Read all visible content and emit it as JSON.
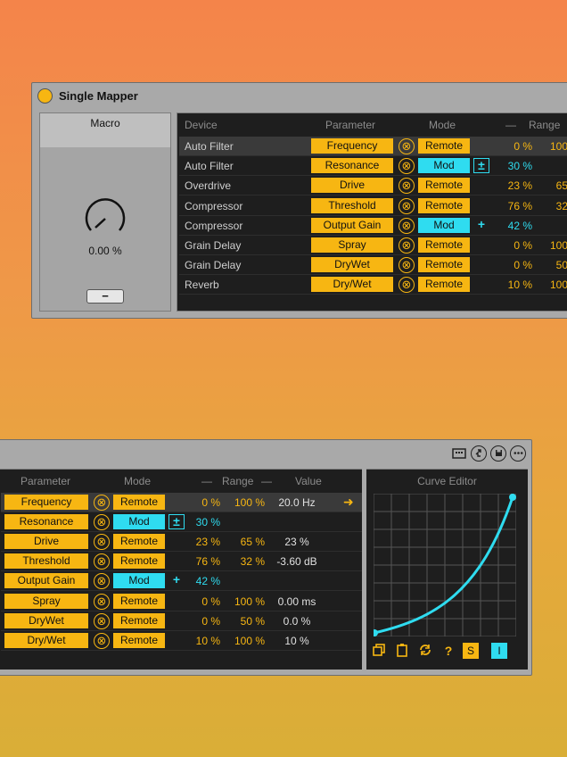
{
  "device": {
    "title": "Single Mapper"
  },
  "macro": {
    "label": "Macro",
    "value": "0.00 %",
    "minus_label": "−"
  },
  "table1": {
    "headers": {
      "device": "Device",
      "parameter": "Parameter",
      "mode": "Mode",
      "range_dash": "—",
      "range": "Range"
    },
    "rows": [
      {
        "device": "Auto Filter",
        "parameter": "Frequency",
        "x": "⊗",
        "mode": "Remote",
        "plus": "",
        "min": "0 %",
        "max": "100"
      },
      {
        "device": "Auto Filter",
        "parameter": "Resonance",
        "x": "⊗",
        "mode": "Mod",
        "plus": "±",
        "min": "30 %",
        "max": ""
      },
      {
        "device": "Overdrive",
        "parameter": "Drive",
        "x": "⊗",
        "mode": "Remote",
        "plus": "",
        "min": "23 %",
        "max": "65"
      },
      {
        "device": "Compressor",
        "parameter": "Threshold",
        "x": "⊗",
        "mode": "Remote",
        "plus": "",
        "min": "76 %",
        "max": "32"
      },
      {
        "device": "Compressor",
        "parameter": "Output Gain",
        "x": "⊗",
        "mode": "Mod",
        "plus": "+",
        "min": "42 %",
        "max": ""
      },
      {
        "device": "Grain Delay",
        "parameter": "Spray",
        "x": "⊗",
        "mode": "Remote",
        "plus": "",
        "min": "0 %",
        "max": "100"
      },
      {
        "device": "Grain Delay",
        "parameter": "DryWet",
        "x": "⊗",
        "mode": "Remote",
        "plus": "",
        "min": "0 %",
        "max": "50"
      },
      {
        "device": "Reverb",
        "parameter": "Dry/Wet",
        "x": "⊗",
        "mode": "Remote",
        "plus": "",
        "min": "10 %",
        "max": "100"
      }
    ]
  },
  "table2": {
    "headers": {
      "parameter": "Parameter",
      "mode": "Mode",
      "range_dash_l": "—",
      "range": "Range",
      "range_dash_r": "—",
      "value": "Value"
    },
    "rows": [
      {
        "parameter": "Frequency",
        "x": "⊗",
        "mode": "Remote",
        "plus": "",
        "min": "0 %",
        "max": "100 %",
        "value": "20.0 Hz"
      },
      {
        "parameter": "Resonance",
        "x": "⊗",
        "mode": "Mod",
        "plus": "±",
        "min": "30 %",
        "max": "",
        "value": ""
      },
      {
        "parameter": "Drive",
        "x": "⊗",
        "mode": "Remote",
        "plus": "",
        "min": "23 %",
        "max": "65 %",
        "value": "23 %"
      },
      {
        "parameter": "Threshold",
        "x": "⊗",
        "mode": "Remote",
        "plus": "",
        "min": "76 %",
        "max": "32 %",
        "value": "-3.60 dB"
      },
      {
        "parameter": "Output Gain",
        "x": "⊗",
        "mode": "Mod",
        "plus": "+",
        "min": "42 %",
        "max": "",
        "value": ""
      },
      {
        "parameter": "Spray",
        "x": "⊗",
        "mode": "Remote",
        "plus": "",
        "min": "0 %",
        "max": "100 %",
        "value": "0.00 ms"
      },
      {
        "parameter": "DryWet",
        "x": "⊗",
        "mode": "Remote",
        "plus": "",
        "min": "0 %",
        "max": "50 %",
        "value": "0.0 %"
      },
      {
        "parameter": "Dry/Wet",
        "x": "⊗",
        "mode": "Remote",
        "plus": "",
        "min": "10 %",
        "max": "100 %",
        "value": "10 %"
      }
    ],
    "selected_arrow": "➜"
  },
  "curve_editor": {
    "title": "Curve Editor",
    "tools": {
      "s_label": "S",
      "i_label": "I"
    }
  },
  "colors": {
    "accent_orange": "#f7b612",
    "accent_cyan": "#2fdcf0"
  }
}
